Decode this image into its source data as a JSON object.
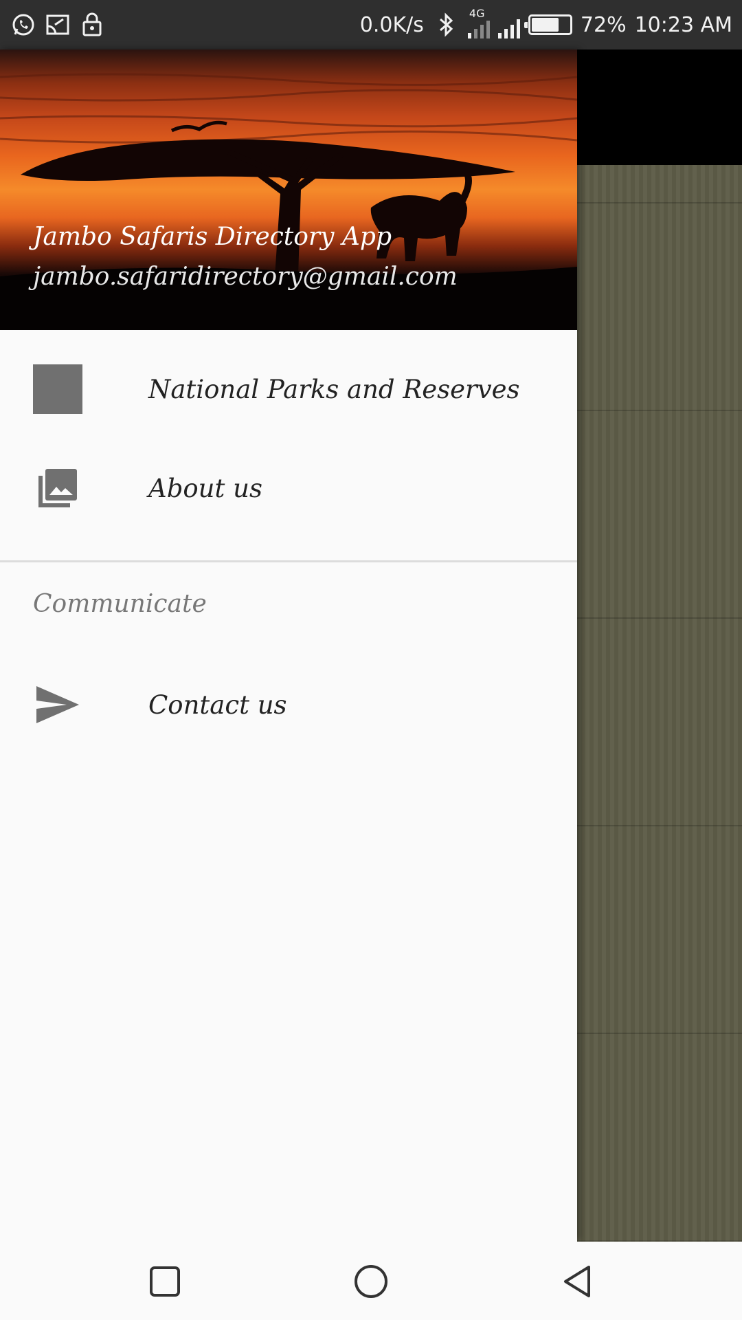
{
  "status_bar": {
    "left_icons": [
      "whatsapp-icon",
      "cast-icon",
      "lock-icon"
    ],
    "net_speed": "0.0K/s",
    "network_type": "4G",
    "battery_percent": "72%",
    "battery_level": 0.72,
    "time": "10:23 AM"
  },
  "drawer": {
    "header": {
      "title": "Jambo Safaris Directory App",
      "email": "jambo.safaridirectory@gmail.com"
    },
    "items": [
      {
        "label": "National Parks and Reserves",
        "icon": "square-icon"
      },
      {
        "label": "About us",
        "icon": "photo-library-icon"
      }
    ],
    "section": {
      "label": "Communicate",
      "items": [
        {
          "label": "Contact us",
          "icon": "send-icon"
        }
      ]
    }
  },
  "nav_bar": {
    "buttons": [
      "recents-button",
      "home-button",
      "back-button"
    ]
  },
  "colors": {
    "status_bar": "#2f2f2f",
    "drawer_bg": "#fafafa",
    "icon_gray": "#707070",
    "app_bg": "#5d5c47"
  }
}
